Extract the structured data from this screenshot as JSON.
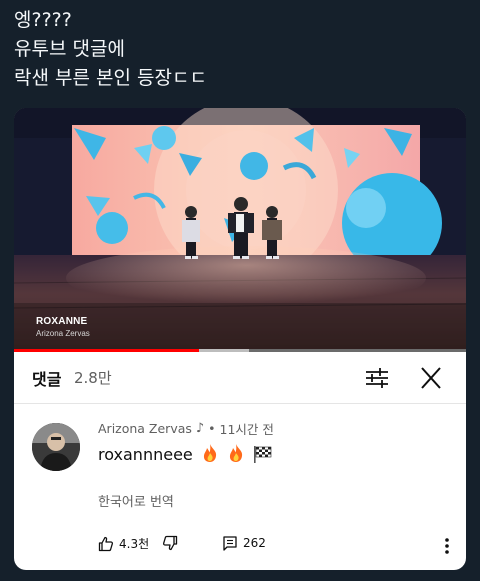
{
  "tweet": {
    "lines": [
      "엥????",
      "유투브 댓글에",
      "락샌 부른 본인 등장ㄷㄷ"
    ]
  },
  "video": {
    "title": "ROXANNE",
    "artist": "Arizona Zervas",
    "progress": 0.41,
    "buffered": 0.52
  },
  "comments": {
    "title": "댓글",
    "count": "2.8만"
  },
  "comment": {
    "author": "Arizona Zervas",
    "music_note": "♪",
    "separator": "•",
    "time": "11시간 전",
    "text": "roxannneee",
    "translate_label": "한국어로 번역",
    "likes": "4.3천",
    "replies": "262"
  },
  "icons": [
    "music-note-icon",
    "fire-icon",
    "checkered-flag-icon",
    "sort-icon",
    "close-icon",
    "thumbs-up-icon",
    "thumbs-down-icon",
    "reply-icon",
    "more-vert-icon"
  ],
  "colors": {
    "background": "#15202b",
    "accent": "#ff0000",
    "card": "#ffffff"
  }
}
